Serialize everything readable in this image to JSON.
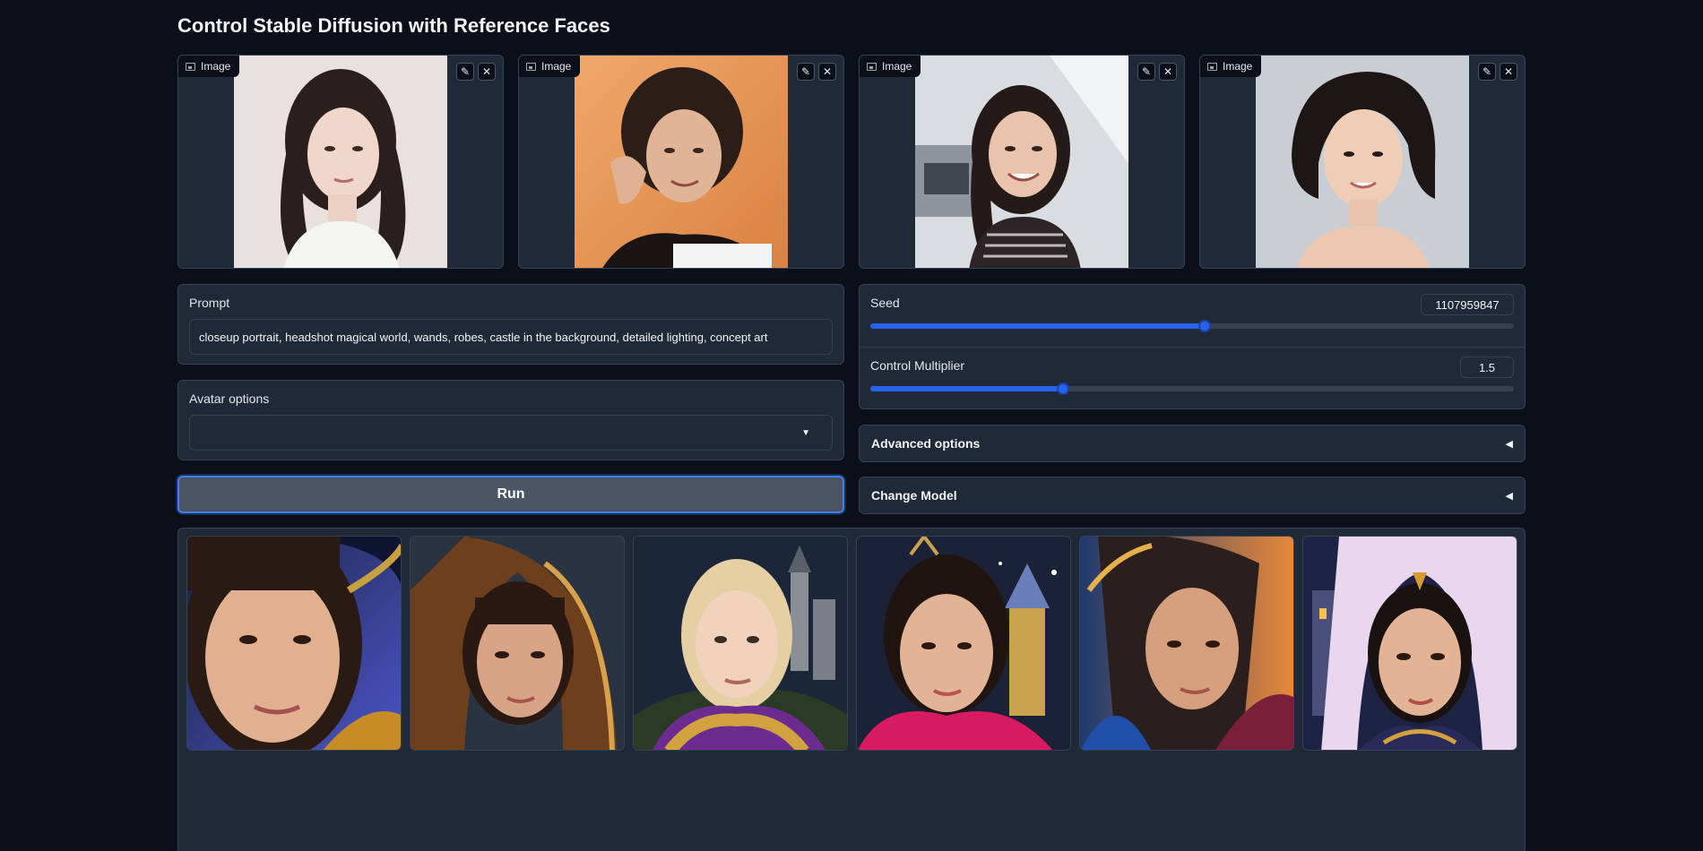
{
  "page_title": "Control Stable Diffusion with Reference Faces",
  "image_inputs": [
    {
      "tag": "Image",
      "edit_icon": "pencil-icon",
      "clear_icon": "close-icon"
    },
    {
      "tag": "Image",
      "edit_icon": "pencil-icon",
      "clear_icon": "close-icon"
    },
    {
      "tag": "Image",
      "edit_icon": "pencil-icon",
      "clear_icon": "close-icon"
    },
    {
      "tag": "Image",
      "edit_icon": "pencil-icon",
      "clear_icon": "close-icon"
    }
  ],
  "prompt": {
    "label": "Prompt",
    "value": "closeup portrait, headshot magical world, wands, robes, castle in the background, detailed lighting, concept art"
  },
  "avatar_options": {
    "label": "Avatar options",
    "selected": ""
  },
  "run_button": {
    "label": "Run"
  },
  "seed": {
    "label": "Seed",
    "value": "1107959847",
    "fraction": 0.52
  },
  "control_multiplier": {
    "label": "Control Multiplier",
    "value": "1.5",
    "fraction": 0.3
  },
  "advanced_options": {
    "label": "Advanced options"
  },
  "change_model": {
    "label": "Change Model"
  },
  "gallery_count": 6,
  "colors": {
    "accent": "#2563eb",
    "background": "#0b0f19",
    "panel": "#1f2937"
  }
}
